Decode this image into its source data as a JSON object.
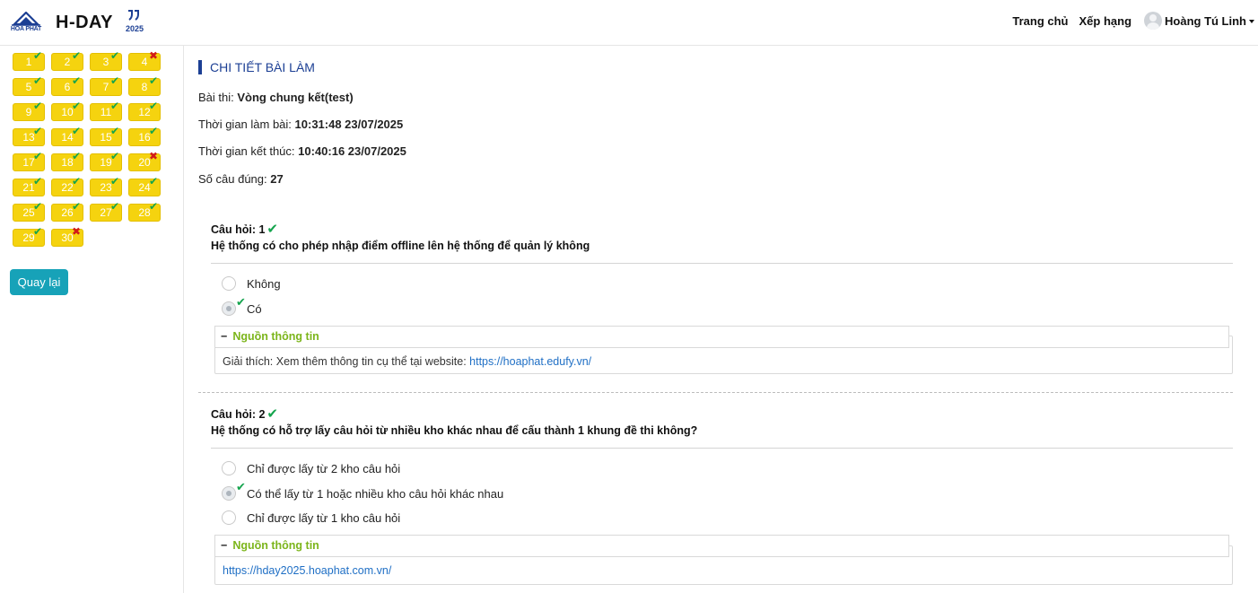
{
  "header": {
    "logo_text": "HOA PHAT",
    "brand": "H-DAY",
    "brand_year": "2025",
    "nav": [
      "Trang chủ",
      "Xếp hạng"
    ],
    "user_name": "Hoàng Tú Linh"
  },
  "sidebar": {
    "questions": [
      {
        "n": "1",
        "status": "correct"
      },
      {
        "n": "2",
        "status": "correct"
      },
      {
        "n": "3",
        "status": "correct"
      },
      {
        "n": "4",
        "status": "wrong"
      },
      {
        "n": "5",
        "status": "correct"
      },
      {
        "n": "6",
        "status": "correct"
      },
      {
        "n": "7",
        "status": "correct"
      },
      {
        "n": "8",
        "status": "correct"
      },
      {
        "n": "9",
        "status": "correct"
      },
      {
        "n": "10",
        "status": "correct"
      },
      {
        "n": "11",
        "status": "correct"
      },
      {
        "n": "12",
        "status": "correct"
      },
      {
        "n": "13",
        "status": "correct"
      },
      {
        "n": "14",
        "status": "correct"
      },
      {
        "n": "15",
        "status": "correct"
      },
      {
        "n": "16",
        "status": "correct"
      },
      {
        "n": "17",
        "status": "correct"
      },
      {
        "n": "18",
        "status": "correct"
      },
      {
        "n": "19",
        "status": "correct"
      },
      {
        "n": "20",
        "status": "wrong"
      },
      {
        "n": "21",
        "status": "correct"
      },
      {
        "n": "22",
        "status": "correct"
      },
      {
        "n": "23",
        "status": "correct"
      },
      {
        "n": "24",
        "status": "correct"
      },
      {
        "n": "25",
        "status": "correct"
      },
      {
        "n": "26",
        "status": "correct"
      },
      {
        "n": "27",
        "status": "correct"
      },
      {
        "n": "28",
        "status": "correct"
      },
      {
        "n": "29",
        "status": "correct"
      },
      {
        "n": "30",
        "status": "wrong"
      }
    ],
    "back_label": "Quay lại"
  },
  "main": {
    "title": "CHI TIẾT BÀI LÀM",
    "exam_label": "Bài thi:",
    "exam_value": "Vòng chung kết(test)",
    "start_label": "Thời gian làm bài:",
    "start_value": "10:31:48 23/07/2025",
    "end_label": "Thời gian kết thúc:",
    "end_value": "10:40:16 23/07/2025",
    "correct_label": "Số câu đúng:",
    "correct_value": "27",
    "source_label": "Nguồn thông tin",
    "q1": {
      "label": "Câu hỏi: 1",
      "text": "Hệ thống có cho phép nhập điểm offline lên hệ thống để quản lý không",
      "options": [
        "Không",
        "Có"
      ],
      "explain_prefix": "Giải thích: Xem thêm thông tin cụ thể tại website:",
      "explain_link": "https://hoaphat.edufy.vn/"
    },
    "q2": {
      "label": "Câu hỏi: 2",
      "text": "Hệ thống có hỗ trợ lấy câu hỏi từ nhiều kho khác nhau để cấu thành 1 khung đề thi không?",
      "options": [
        "Chỉ được lấy từ 2 kho câu hỏi",
        "Có thể lấy từ 1 hoặc nhiều kho câu hỏi khác nhau",
        "Chỉ được lấy từ 1 kho câu hỏi"
      ],
      "source_link": "https://hday2025.hoaphat.com.vn/"
    }
  },
  "colors": {
    "accent": "#1c3f94",
    "badge": "#f5d30f",
    "correct": "#14a44d",
    "wrong": "#d11a1a",
    "button": "#17a2b8",
    "source": "#7cb51b"
  }
}
